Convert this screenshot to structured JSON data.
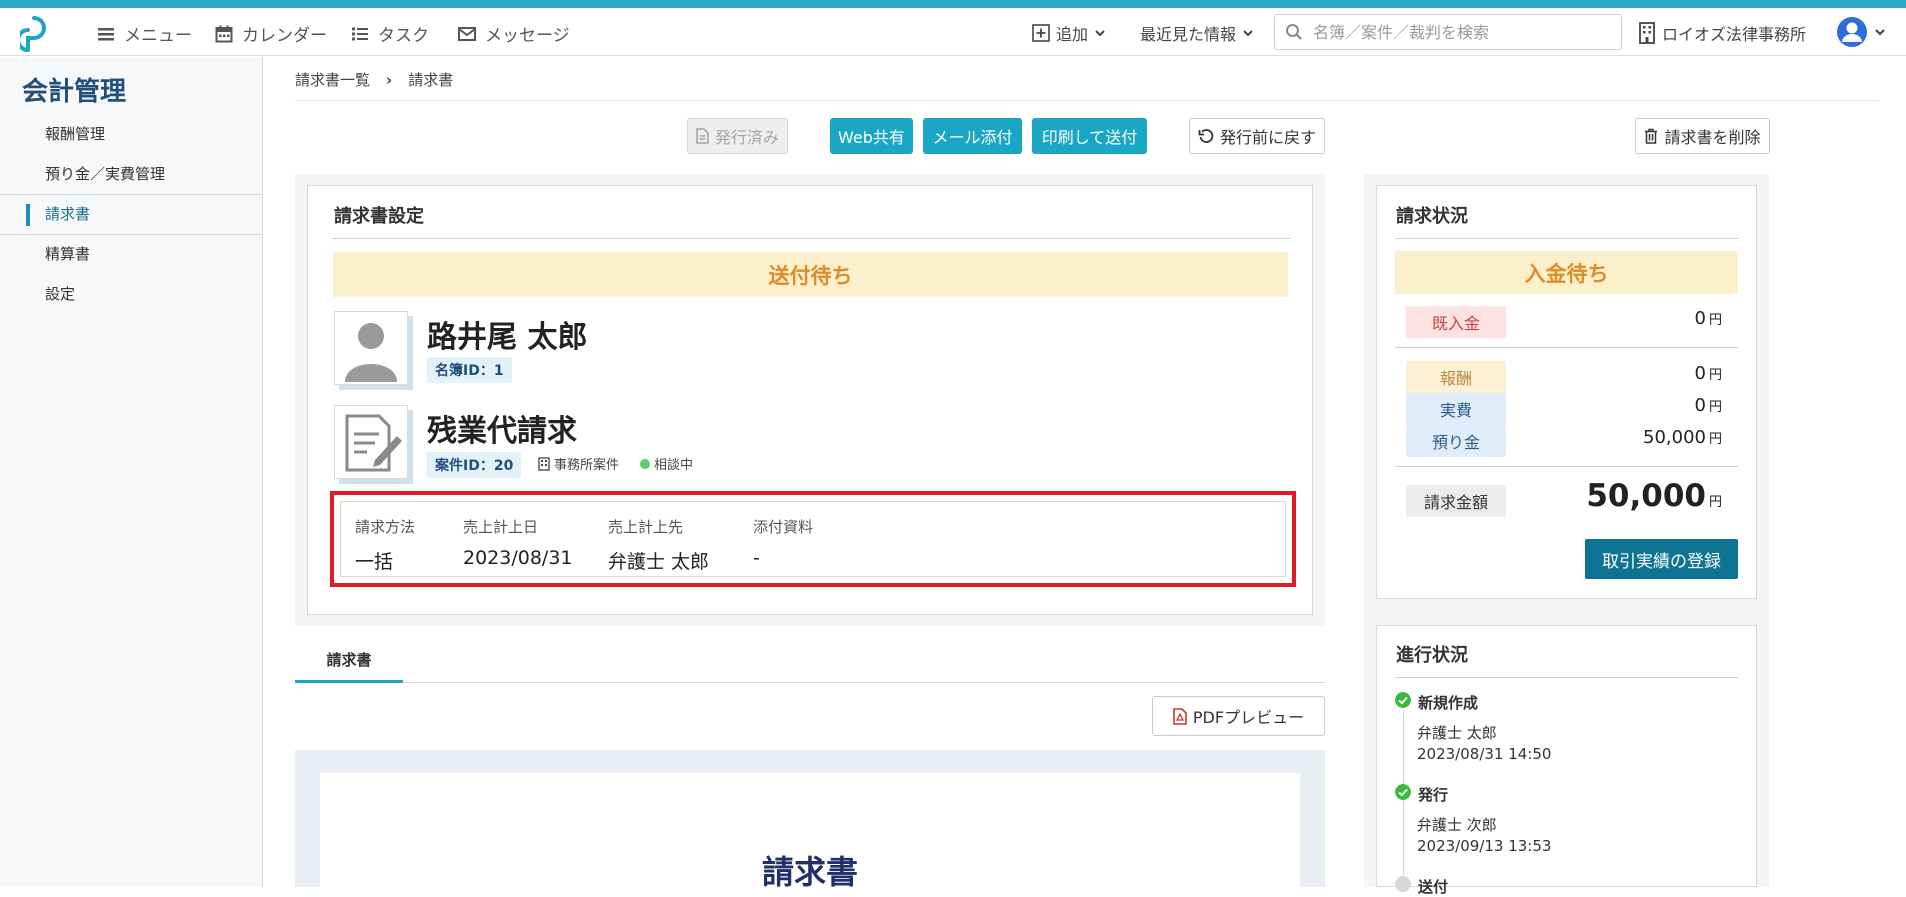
{
  "header": {
    "nav": [
      {
        "label": "メニュー",
        "icon": "hamburger-icon"
      },
      {
        "label": "カレンダー",
        "icon": "calendar-icon"
      },
      {
        "label": "タスク",
        "icon": "list-icon"
      },
      {
        "label": "メッセージ",
        "icon": "envelope-icon"
      }
    ],
    "add_label": "追加",
    "recent_label": "最近見た情報",
    "search_placeholder": "名簿／案件／裁判を検索",
    "org_name": "ロイオズ法律事務所"
  },
  "sidebar": {
    "title": "会計管理",
    "items": [
      {
        "label": "報酬管理"
      },
      {
        "label": "預り金／実費管理"
      },
      {
        "label": "請求書"
      },
      {
        "label": "精算書"
      },
      {
        "label": "設定"
      }
    ]
  },
  "breadcrumb": {
    "parent": "請求書一覧",
    "separator": "›",
    "current": "請求書"
  },
  "toolbar": {
    "issued": "発行済み",
    "web_share": "Web共有",
    "mail_attach": "メール添付",
    "print_send": "印刷して送付",
    "revert": "発行前に戻す",
    "delete": "請求書を削除"
  },
  "settings": {
    "title": "請求書設定",
    "status": "送付待ち",
    "client_name": "路井尾 太郎",
    "client_id": "名簿ID：1",
    "case_name": "残業代請求",
    "case_id": "案件ID：20",
    "case_type": "事務所案件",
    "case_status": "相談中",
    "info": [
      {
        "label": "請求方法",
        "value": "一括"
      },
      {
        "label": "売上計上日",
        "value": "2023/08/31"
      },
      {
        "label": "売上計上先",
        "value": "弁護士 太郎"
      },
      {
        "label": "添付資料",
        "value": "-"
      }
    ]
  },
  "tab": {
    "label": "請求書"
  },
  "pdf_preview": "PDFプレビュー",
  "preview_title": "請求書",
  "billing": {
    "title": "請求状況",
    "status": "入金待ち",
    "rows": [
      {
        "label": "既入金",
        "amount": "0"
      },
      {
        "label": "報酬",
        "amount": "0"
      },
      {
        "label": "実費",
        "amount": "0"
      },
      {
        "label": "預り金",
        "amount": "50,000"
      }
    ],
    "total_label": "請求金額",
    "total_amount": "50,000",
    "currency": "円",
    "register_button": "取引実績の登録"
  },
  "progress": {
    "title": "進行状況",
    "steps": [
      {
        "title": "新規作成",
        "user": "弁護士 太郎",
        "time": "2023/08/31 14:50"
      },
      {
        "title": "発行",
        "user": "弁護士 次郎",
        "time": "2023/09/13 13:53"
      },
      {
        "title": "送付"
      }
    ]
  },
  "colors": {
    "accent": "#1aa7c6",
    "sidebar_title": "#1f4f7a",
    "pending_bg": "#fcefcb",
    "pending_text": "#e08a2a",
    "highlight_box": "#e01c24",
    "done_green": "#3cb83c"
  }
}
